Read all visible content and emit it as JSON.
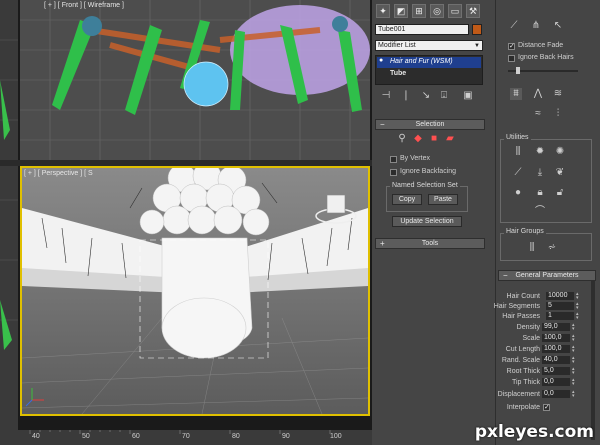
{
  "viewports": {
    "front_label": "[ + ] [ Front ] [ Wireframe ]",
    "persp_label": "[ + ] [ Perspective ] [ S"
  },
  "timeline": {
    "ticks": [
      "40",
      "50",
      "60",
      "70",
      "80",
      "90",
      "100"
    ]
  },
  "command_panel": {
    "tabs": [
      "create-icon",
      "modify-icon",
      "hierarchy-icon",
      "motion-icon",
      "display-icon",
      "utilities-icon"
    ],
    "object_name": "Tube001",
    "object_color": "#c05a18",
    "modifier_list": "Modifier List",
    "stack": [
      {
        "label": "Hair and Fur (WSM)",
        "selected": true
      },
      {
        "label": "Tube",
        "selected": false
      }
    ],
    "selection": {
      "title": "Selection",
      "by_vertex": "By Vertex",
      "ignore_backfacing": "Ignore Backfacing",
      "named_set_title": "Named Selection Set",
      "copy": "Copy",
      "paste": "Paste",
      "update_selection": "Update Selection"
    },
    "tools": {
      "title": "Tools"
    }
  },
  "right_panel": {
    "distance_fade": "Distance Fade",
    "ignore_back_hairs": "Ignore Back Hairs",
    "utilities_title": "Utilities",
    "hair_groups_title": "Hair Groups",
    "general_params_title": "General Parameters",
    "params": [
      {
        "label": "Hair Count",
        "value": "10000"
      },
      {
        "label": "Hair Segments",
        "value": "5"
      },
      {
        "label": "Hair Passes",
        "value": "1"
      },
      {
        "label": "Density",
        "value": "99,0"
      },
      {
        "label": "Scale",
        "value": "100,0"
      },
      {
        "label": "Cut Length",
        "value": "100,0"
      },
      {
        "label": "Rand. Scale",
        "value": "40,0"
      },
      {
        "label": "Root Thick",
        "value": "5,0"
      },
      {
        "label": "Tip Thick",
        "value": "0,0"
      },
      {
        "label": "Displacement",
        "value": "0,0"
      }
    ],
    "interpolate": "Interpolate"
  },
  "watermark": "pxleyes.com",
  "colors": {
    "accent_yellow": "#e0c000",
    "selected_blue": "#1f3f8f"
  }
}
